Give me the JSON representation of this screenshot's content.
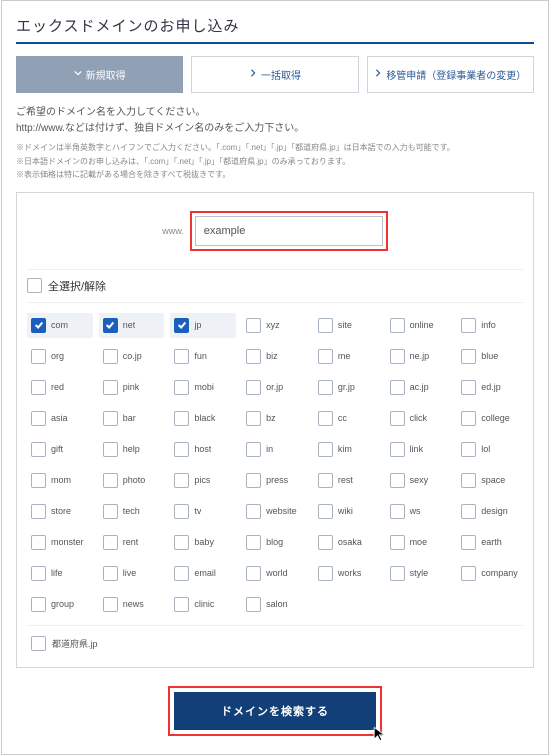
{
  "page_title": "エックスドメインのお申し込み",
  "tabs": {
    "new": {
      "label": "新規取得",
      "icon": "chevron-down"
    },
    "bulk": {
      "label": "一括取得",
      "icon": "chevron-right"
    },
    "xfer": {
      "label": "移管申請（登録事業者の変更）",
      "icon": "chevron-right"
    }
  },
  "lead_line1": "ご希望のドメイン名を入力してください。",
  "lead_line2": "http://www.などは付けず、独自ドメイン名のみをご入力下さい。",
  "note1": "※ドメインは半角英数字とハイフンでご入力ください。「.com」「.net」「.jp」「都道府県.jp」は日本語での入力も可能です。",
  "note2": "※日本語ドメインのお申し込みは、「.com」「.net」「.jp」「都道府県.jp」のみ承っております。",
  "note3": "※表示価格は特に記載がある場合を除きすべて税抜きです。",
  "input": {
    "prefix": "www.",
    "value": "example",
    "placeholder": ""
  },
  "select_all_label": "全選択/解除",
  "tlds": [
    [
      "com",
      true
    ],
    [
      "net",
      true
    ],
    [
      "jp",
      true
    ],
    [
      "xyz",
      false
    ],
    [
      "site",
      false
    ],
    [
      "online",
      false
    ],
    [
      "info",
      false
    ],
    [
      "org",
      false
    ],
    [
      "co.jp",
      false
    ],
    [
      "fun",
      false
    ],
    [
      "biz",
      false
    ],
    [
      "me",
      false
    ],
    [
      "ne.jp",
      false
    ],
    [
      "blue",
      false
    ],
    [
      "red",
      false
    ],
    [
      "pink",
      false
    ],
    [
      "mobi",
      false
    ],
    [
      "or.jp",
      false
    ],
    [
      "gr.jp",
      false
    ],
    [
      "ac.jp",
      false
    ],
    [
      "ed.jp",
      false
    ],
    [
      "asia",
      false
    ],
    [
      "bar",
      false
    ],
    [
      "black",
      false
    ],
    [
      "bz",
      false
    ],
    [
      "cc",
      false
    ],
    [
      "click",
      false
    ],
    [
      "college",
      false
    ],
    [
      "gift",
      false
    ],
    [
      "help",
      false
    ],
    [
      "host",
      false
    ],
    [
      "in",
      false
    ],
    [
      "kim",
      false
    ],
    [
      "link",
      false
    ],
    [
      "lol",
      false
    ],
    [
      "mom",
      false
    ],
    [
      "photo",
      false
    ],
    [
      "pics",
      false
    ],
    [
      "press",
      false
    ],
    [
      "rest",
      false
    ],
    [
      "sexy",
      false
    ],
    [
      "space",
      false
    ],
    [
      "store",
      false
    ],
    [
      "tech",
      false
    ],
    [
      "tv",
      false
    ],
    [
      "website",
      false
    ],
    [
      "wiki",
      false
    ],
    [
      "ws",
      false
    ],
    [
      "design",
      false
    ],
    [
      "monster",
      false
    ],
    [
      "rent",
      false
    ],
    [
      "baby",
      false
    ],
    [
      "blog",
      false
    ],
    [
      "osaka",
      false
    ],
    [
      "moe",
      false
    ],
    [
      "earth",
      false
    ],
    [
      "life",
      false
    ],
    [
      "live",
      false
    ],
    [
      "email",
      false
    ],
    [
      "world",
      false
    ],
    [
      "works",
      false
    ],
    [
      "style",
      false
    ],
    [
      "company",
      false
    ],
    [
      "group",
      false
    ],
    [
      "news",
      false
    ],
    [
      "clinic",
      false
    ],
    [
      "salon",
      false
    ]
  ],
  "pref_tld": {
    "label": "都道府県.jp",
    "checked": false
  },
  "submit_label": "ドメインを検索する"
}
